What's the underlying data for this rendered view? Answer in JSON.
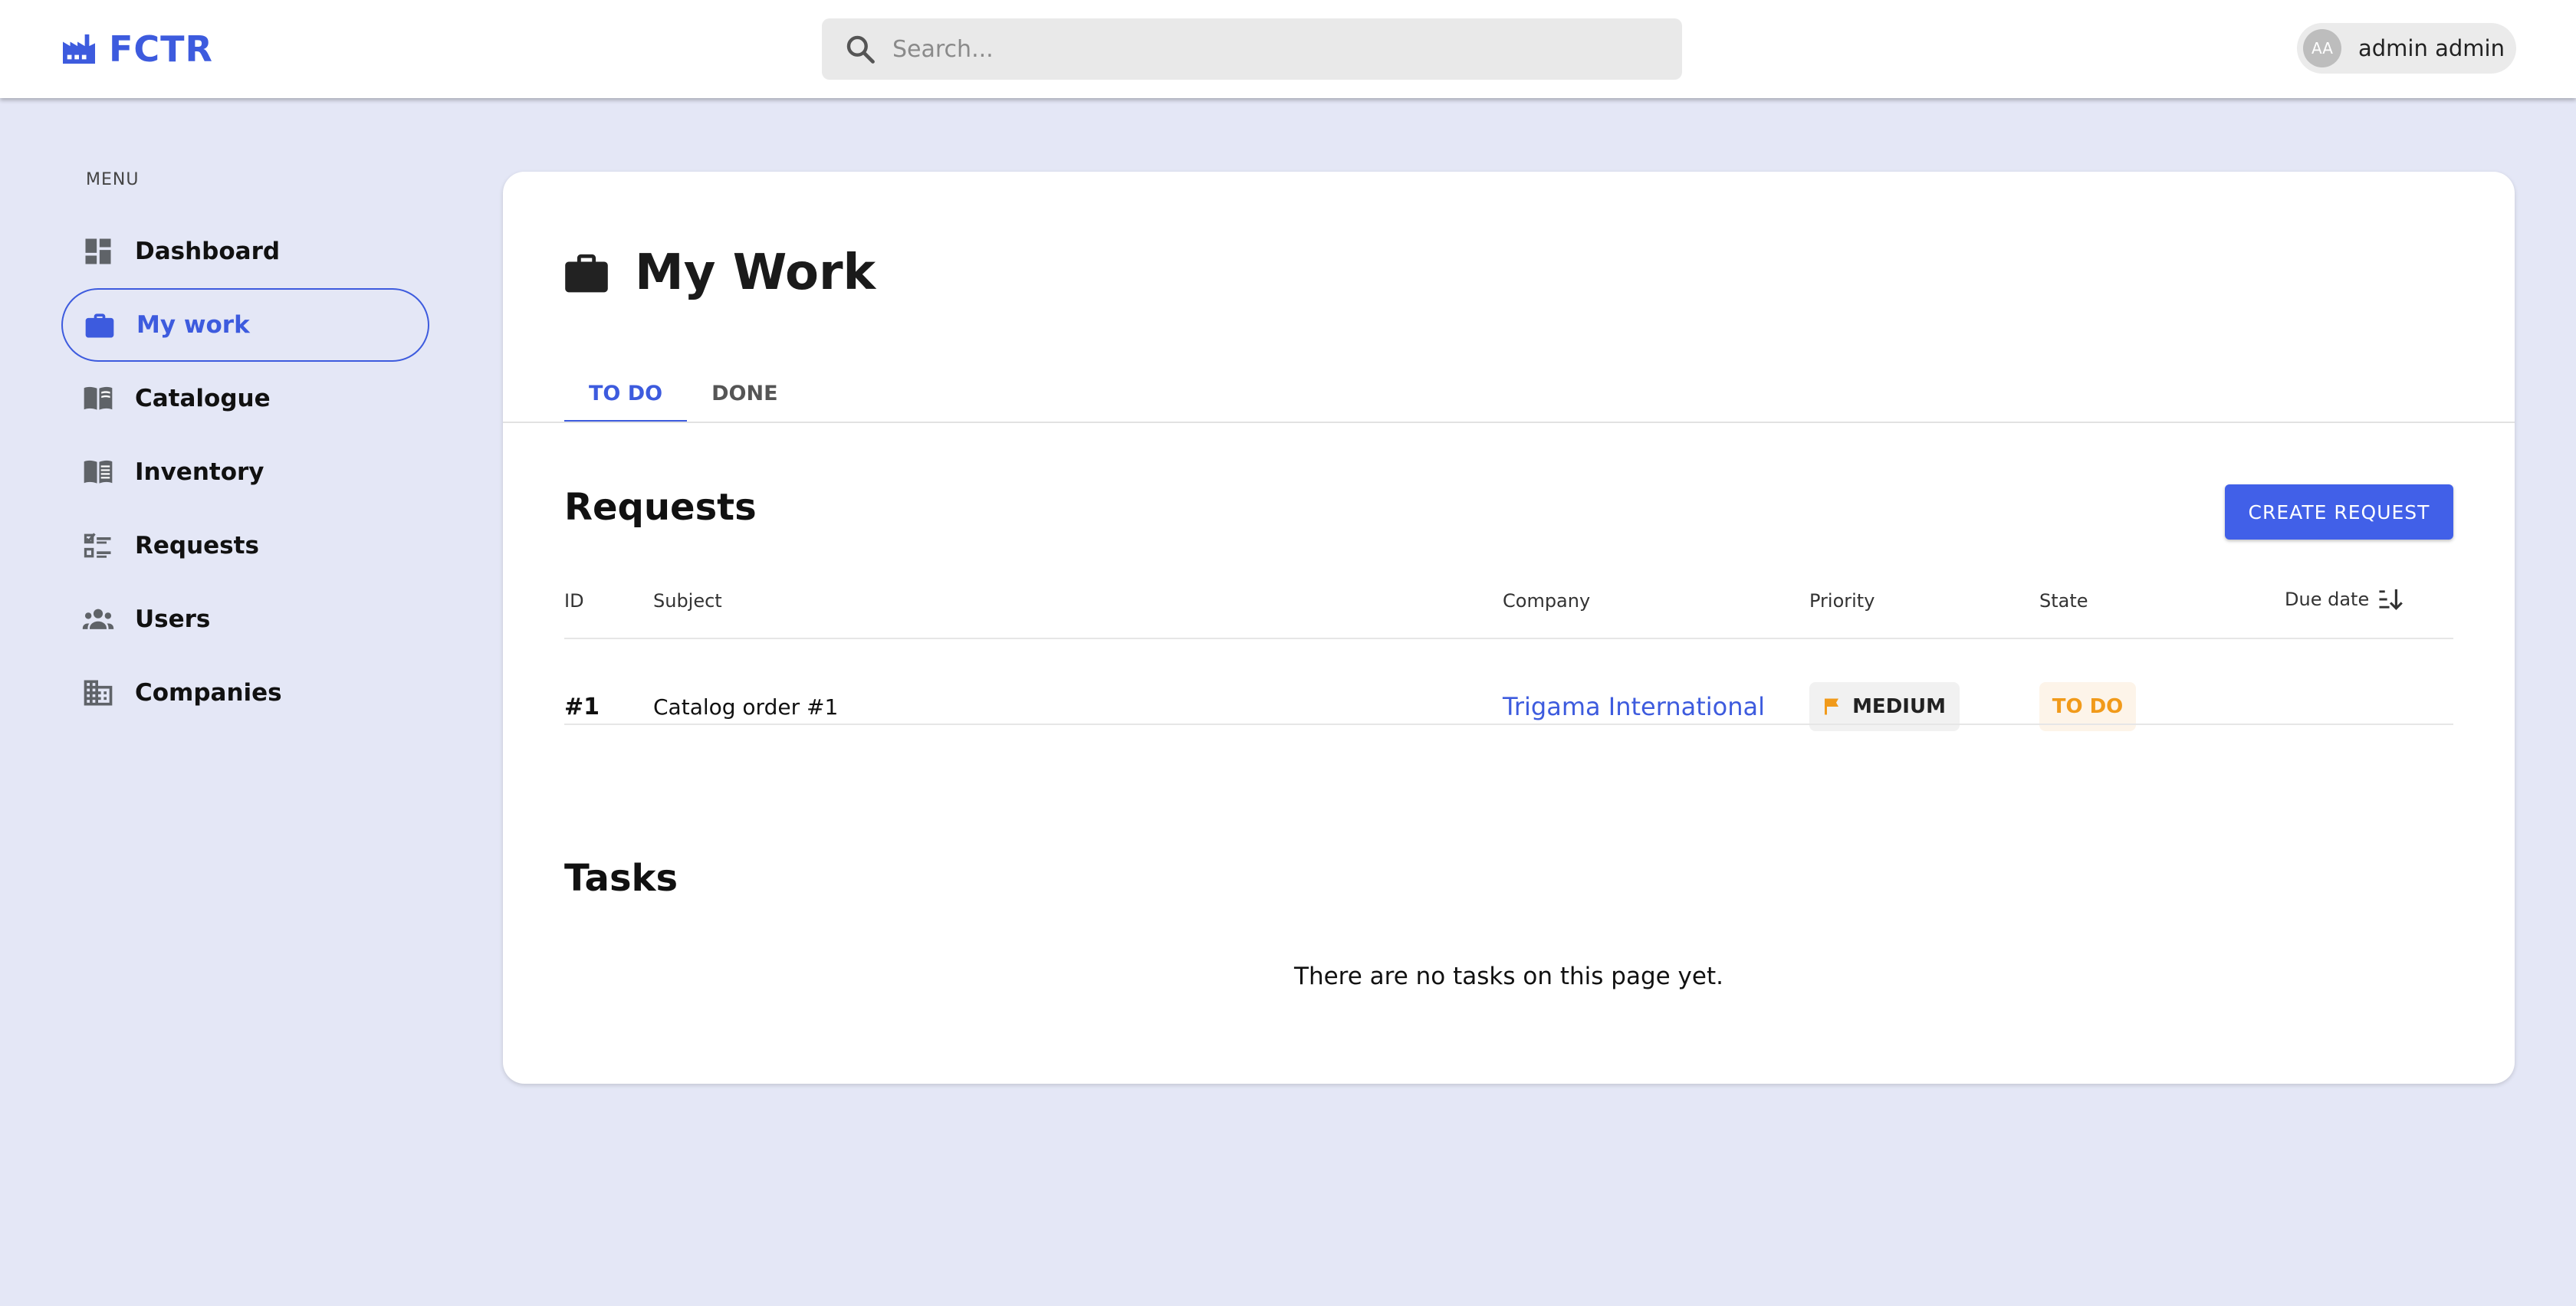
{
  "app": {
    "brand": "FCTR",
    "brand_icon": "factory-icon"
  },
  "search": {
    "placeholder": "Search..."
  },
  "user": {
    "initials": "AA",
    "name": "admin admin"
  },
  "sidebar": {
    "heading": "MENU",
    "items": [
      {
        "label": "Dashboard",
        "icon": "dashboard-icon",
        "active": false
      },
      {
        "label": "My work",
        "icon": "briefcase-icon",
        "active": true
      },
      {
        "label": "Catalogue",
        "icon": "open-book-icon",
        "active": false
      },
      {
        "label": "Inventory",
        "icon": "ledger-book-icon",
        "active": false
      },
      {
        "label": "Requests",
        "icon": "checklist-icon",
        "active": false
      },
      {
        "label": "Users",
        "icon": "users-icon",
        "active": false
      },
      {
        "label": "Companies",
        "icon": "building-icon",
        "active": false
      }
    ]
  },
  "page": {
    "title": "My Work",
    "tabs": [
      {
        "label": "TO DO",
        "active": true
      },
      {
        "label": "DONE",
        "active": false
      }
    ]
  },
  "requests": {
    "title": "Requests",
    "create_label": "CREATE REQUEST",
    "columns": [
      "ID",
      "Subject",
      "Company",
      "Priority",
      "State",
      "Due date"
    ],
    "rows": [
      {
        "id": "#1",
        "subject": "Catalog order #1",
        "company": "Trigama International",
        "priority": "MEDIUM",
        "state": "TO DO",
        "due_date": ""
      }
    ]
  },
  "tasks": {
    "title": "Tasks",
    "empty": "There are no tasks on this page yet."
  },
  "colors": {
    "accent": "#3d5bde",
    "background": "#e4e7f6",
    "priority_medium": "#f19a1a",
    "state_todo": "#f19a1a"
  }
}
